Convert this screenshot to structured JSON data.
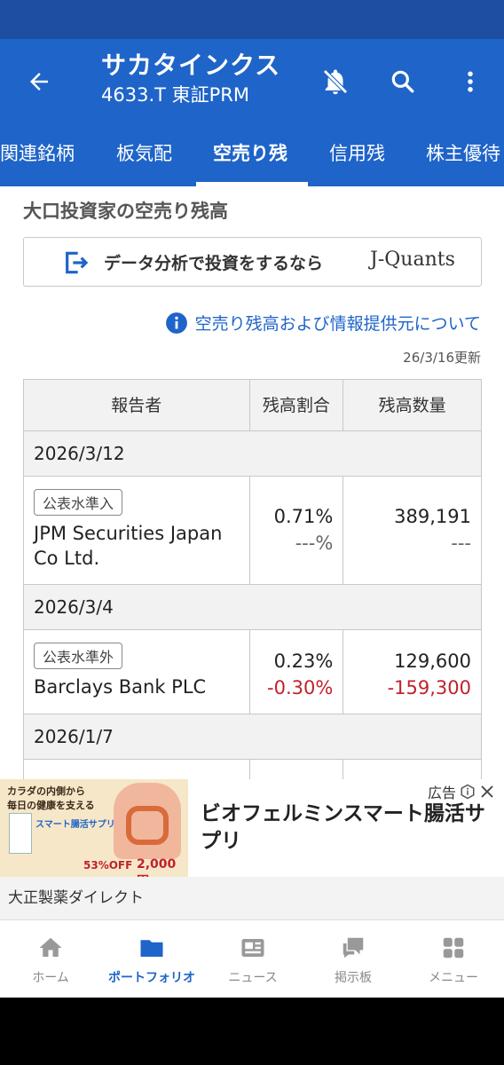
{
  "header": {
    "title": "サカタインクス",
    "subtitle": "4633.T 東証PRM",
    "icons": [
      "back-arrow-icon",
      "bell-off-icon",
      "search-icon",
      "more-vertical-icon"
    ]
  },
  "tabs": [
    {
      "label": "関連銘柄"
    },
    {
      "label": "板気配"
    },
    {
      "label": "空売り残",
      "active": true
    },
    {
      "label": "信用残"
    },
    {
      "label": "株主優待"
    }
  ],
  "section": {
    "title": "大口投資家の空売り残高"
  },
  "banner": {
    "text": "データ分析で投資をするなら",
    "brand": "J-Quants"
  },
  "info_link": "空売り残高および情報提供元について",
  "updated": "26/3/16更新",
  "table": {
    "headers": [
      "報告者",
      "残高割合",
      "残高数量"
    ],
    "groups": [
      {
        "date": "2026/3/12",
        "badge": "公表水準入",
        "reporter": "JPM Securities Japan Co Ltd.",
        "ratio": "0.71%",
        "ratio_change": "---%",
        "quantity": "389,191",
        "quantity_change": "---"
      },
      {
        "date": "2026/3/4",
        "badge": "公表水準外",
        "reporter": "Barclays Bank PLC",
        "ratio": "0.23%",
        "ratio_change": "-0.30%",
        "quantity": "129,600",
        "quantity_change": "-159,300"
      },
      {
        "date": "2026/1/7"
      }
    ]
  },
  "ad": {
    "label": "広告",
    "text": "ビオフェルミンスマート腸活サプリ",
    "advertiser": "大正製薬ダイレクト",
    "image_text": {
      "line1": "カラダの内側から",
      "line2": "毎日の健康を支える",
      "product": "スマート腸活サプリ",
      "discount": "53%OFF",
      "price": "2,000円"
    }
  },
  "colors": {
    "primary": "#1f64c8",
    "status_bar": "#1d4ea0",
    "negative": "#c0222b"
  },
  "bottom_nav": [
    {
      "label": "ホーム",
      "icon": "home-icon"
    },
    {
      "label": "ポートフォリオ",
      "icon": "folder-icon",
      "active": true
    },
    {
      "label": "ニュース",
      "icon": "news-icon"
    },
    {
      "label": "掲示板",
      "icon": "chat-icon"
    },
    {
      "label": "メニュー",
      "icon": "grid-icon"
    }
  ]
}
